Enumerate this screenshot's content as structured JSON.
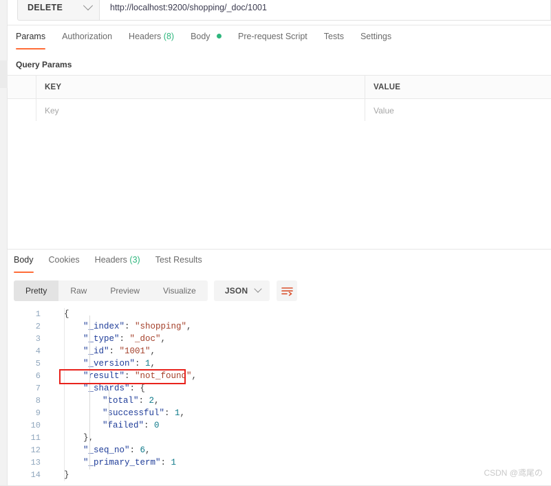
{
  "request": {
    "method": "DELETE",
    "url": "http://localhost:9200/shopping/_doc/1001",
    "method_chevron_icon": "chevron-down-icon",
    "tabs": [
      {
        "label": "Params",
        "active": true
      },
      {
        "label": "Authorization",
        "active": false
      },
      {
        "label": "Headers",
        "count": "(8)",
        "active": false
      },
      {
        "label": "Body",
        "dot": true,
        "active": false
      },
      {
        "label": "Pre-request Script",
        "active": false
      },
      {
        "label": "Tests",
        "active": false
      },
      {
        "label": "Settings",
        "active": false
      }
    ],
    "section_title": "Query Params",
    "params_table": {
      "headers": {
        "key": "KEY",
        "value": "VALUE"
      },
      "rows": [
        {
          "key_placeholder": "Key",
          "value_placeholder": "Value"
        }
      ]
    }
  },
  "response": {
    "tabs": [
      {
        "label": "Body",
        "active": true
      },
      {
        "label": "Cookies",
        "active": false
      },
      {
        "label": "Headers",
        "count": "(3)",
        "active": false
      },
      {
        "label": "Test Results",
        "active": false
      }
    ],
    "view_modes": [
      {
        "label": "Pretty",
        "active": true
      },
      {
        "label": "Raw",
        "active": false
      },
      {
        "label": "Preview",
        "active": false
      },
      {
        "label": "Visualize",
        "active": false
      }
    ],
    "format_selected": "JSON",
    "format_chevron_icon": "chevron-down-icon",
    "wrap_button_icon": "text-wrap-icon",
    "body_lines": [
      {
        "num": "1",
        "indent": 0,
        "tokens": [
          {
            "t": "p",
            "v": "{"
          }
        ]
      },
      {
        "num": "2",
        "indent": 1,
        "tokens": [
          {
            "t": "k",
            "v": "\"_index\""
          },
          {
            "t": "p",
            "v": ": "
          },
          {
            "t": "s",
            "v": "\"shopping\""
          },
          {
            "t": "p",
            "v": ","
          }
        ]
      },
      {
        "num": "3",
        "indent": 1,
        "tokens": [
          {
            "t": "k",
            "v": "\"_type\""
          },
          {
            "t": "p",
            "v": ": "
          },
          {
            "t": "s",
            "v": "\"_doc\""
          },
          {
            "t": "p",
            "v": ","
          }
        ]
      },
      {
        "num": "4",
        "indent": 1,
        "tokens": [
          {
            "t": "k",
            "v": "\"_id\""
          },
          {
            "t": "p",
            "v": ": "
          },
          {
            "t": "s",
            "v": "\"1001\""
          },
          {
            "t": "p",
            "v": ","
          }
        ]
      },
      {
        "num": "5",
        "indent": 1,
        "tokens": [
          {
            "t": "k",
            "v": "\"_version\""
          },
          {
            "t": "p",
            "v": ": "
          },
          {
            "t": "n",
            "v": "1"
          },
          {
            "t": "p",
            "v": ","
          }
        ]
      },
      {
        "num": "6",
        "indent": 1,
        "tokens": [
          {
            "t": "k",
            "v": "\"result\""
          },
          {
            "t": "p",
            "v": ": "
          },
          {
            "t": "s",
            "v": "\"not_found\""
          },
          {
            "t": "p",
            "v": ","
          }
        ]
      },
      {
        "num": "7",
        "indent": 1,
        "tokens": [
          {
            "t": "k",
            "v": "\"_shards\""
          },
          {
            "t": "p",
            "v": ": {"
          }
        ]
      },
      {
        "num": "8",
        "indent": 2,
        "tokens": [
          {
            "t": "k",
            "v": "\"total\""
          },
          {
            "t": "p",
            "v": ": "
          },
          {
            "t": "n",
            "v": "2"
          },
          {
            "t": "p",
            "v": ","
          }
        ]
      },
      {
        "num": "9",
        "indent": 2,
        "tokens": [
          {
            "t": "k",
            "v": "\"successful\""
          },
          {
            "t": "p",
            "v": ": "
          },
          {
            "t": "n",
            "v": "1"
          },
          {
            "t": "p",
            "v": ","
          }
        ]
      },
      {
        "num": "10",
        "indent": 2,
        "tokens": [
          {
            "t": "k",
            "v": "\"failed\""
          },
          {
            "t": "p",
            "v": ": "
          },
          {
            "t": "n",
            "v": "0"
          }
        ]
      },
      {
        "num": "11",
        "indent": 1,
        "tokens": [
          {
            "t": "p",
            "v": "},"
          }
        ]
      },
      {
        "num": "12",
        "indent": 1,
        "tokens": [
          {
            "t": "k",
            "v": "\"_seq_no\""
          },
          {
            "t": "p",
            "v": ": "
          },
          {
            "t": "n",
            "v": "6"
          },
          {
            "t": "p",
            "v": ","
          }
        ]
      },
      {
        "num": "13",
        "indent": 1,
        "tokens": [
          {
            "t": "k",
            "v": "\"_primary_term\""
          },
          {
            "t": "p",
            "v": ": "
          },
          {
            "t": "n",
            "v": "1"
          }
        ]
      },
      {
        "num": "14",
        "indent": 0,
        "tokens": [
          {
            "t": "p",
            "v": "}"
          }
        ]
      }
    ],
    "highlight": {
      "line": "6",
      "color": "#e8221c"
    }
  },
  "watermark": "CSDN @鸢尾の"
}
